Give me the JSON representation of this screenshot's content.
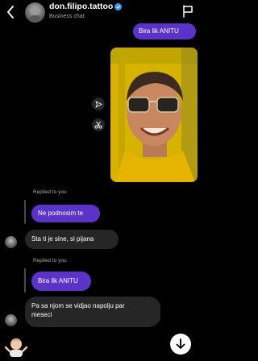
{
  "header": {
    "username": "don.filipo.tattoo",
    "subtitle": "Business chat"
  },
  "messages": {
    "m1": "Bira lik ANITU",
    "replied_label_1": "Replied to you",
    "m2": "Ne podnosim te",
    "m3": "Sta ti je sine, si pijana",
    "replied_label_2": "Replied to you",
    "m4": "Bira lik ANITU",
    "m5_line1": "Pa sa njom se vidjao napolju par",
    "m5_line2": "meseci"
  },
  "colors": {
    "outgoing_bubble": "#5b33c9",
    "incoming_bubble": "#262626",
    "verified": "#3897f0",
    "photo_background": "#d8b400"
  },
  "icons": [
    "back-arrow-icon",
    "verified-badge-icon",
    "flag-icon",
    "send-icon",
    "scissors-icon",
    "arrow-down-icon"
  ]
}
